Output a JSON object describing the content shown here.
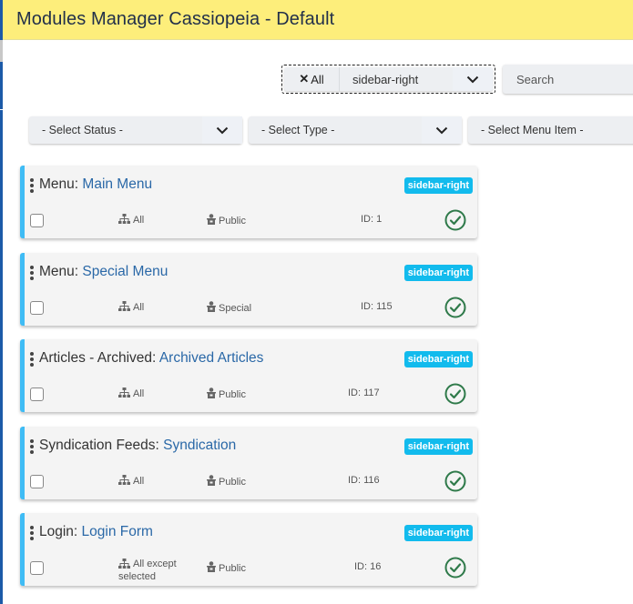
{
  "header": {
    "title": "Modules Manager Cassiopeia - Default"
  },
  "position_filter": {
    "clear_label": "All",
    "clear_icon": "times-icon",
    "value": "sidebar-right",
    "caret_icon": "chevron-down-icon"
  },
  "search": {
    "placeholder": "Search"
  },
  "filters": {
    "status": "- Select Status -",
    "type": "- Select Type -",
    "menu_item": "- Select Menu Item -"
  },
  "modules": [
    {
      "type": "Menu:",
      "title": "Main Menu",
      "position": "sidebar-right",
      "pages": "All",
      "access": "Public",
      "id": "ID: 1",
      "status": "published"
    },
    {
      "type": "Menu:",
      "title": "Special Menu",
      "position": "sidebar-right",
      "pages": "All",
      "access": "Special",
      "id": "ID: 115",
      "status": "published"
    },
    {
      "type": "Articles - Archived:",
      "title": "Archived Articles",
      "position": "sidebar-right",
      "pages": "All",
      "access": "Public",
      "id": "ID: 117",
      "status": "published"
    },
    {
      "type": "Syndication Feeds:",
      "title": "Syndication",
      "position": "sidebar-right",
      "pages": "All",
      "access": "Public",
      "id": "ID: 116",
      "status": "published"
    },
    {
      "type": "Login:",
      "title": "Login Form",
      "position": "sidebar-right",
      "pages_line1": "All except",
      "pages_line2": "selected",
      "access": "Public",
      "id": "ID: 16",
      "status": "published"
    }
  ],
  "colors": {
    "header_bg": "#fdee7b",
    "accent": "#3fbcf5",
    "badge": "#12bbed",
    "link": "#2a68a7",
    "published": "#2f7a4a"
  }
}
